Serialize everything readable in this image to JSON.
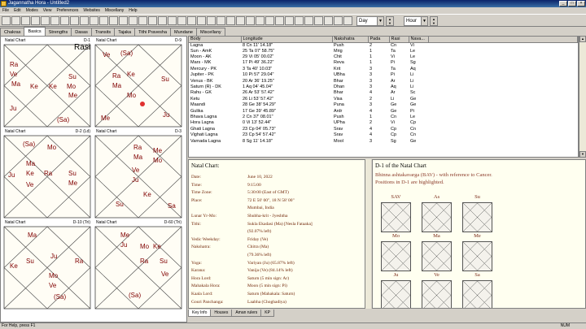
{
  "window": {
    "title": "Jagannatha Hora - Untitled2",
    "controls": [
      "_",
      "□",
      "×"
    ]
  },
  "menu": [
    "File",
    "Edit",
    "Modes",
    "View",
    "Preferences",
    "Websites",
    "Miscellany",
    "Help"
  ],
  "toolbar": {
    "unit_select": "Day",
    "unit_select2": "Hour"
  },
  "tabs": [
    "Chakras",
    "Basics",
    "Strengths",
    "Dasas",
    "Transits",
    "Tajaka",
    "Tithi Pravesha",
    "Mundane",
    "Miscellany"
  ],
  "active_tab": "Basics",
  "charts": [
    {
      "title": "Natal Chart",
      "right": "D-1",
      "center": "Rasi"
    },
    {
      "title": "Natal Chart",
      "right": "D-9"
    },
    {
      "title": "Natal Chart",
      "right": "D-2 (Ld)"
    },
    {
      "title": "Natal Chart",
      "right": "D-3"
    },
    {
      "title": "Natal Chart",
      "right": "D-10 (Tri)"
    },
    {
      "title": "Natal Chart",
      "right": "D-60 (Tri)"
    }
  ],
  "table": {
    "headers": [
      "Body",
      "Longitude",
      "Nakshatra",
      "Pada",
      "Rasi",
      "Nava..."
    ],
    "rows": [
      [
        "Lagna",
        "8 Cn 11' 14.18\"",
        "Push",
        "2",
        "Cn",
        "Vi"
      ],
      [
        "Sun - AmK",
        "25 Ta 07' 58.75\"",
        "Mrig",
        "1",
        "Ta",
        "Le"
      ],
      [
        "Moon - AK",
        "29 Vi 05' 00.02\"",
        "Chit",
        "1",
        "Vi",
        "Le"
      ],
      [
        "Mars - MK",
        "17 Pi 49' 36.22\"",
        "Reva",
        "1",
        "Pi",
        "Sg"
      ],
      [
        "Mercury - PK",
        "3 Ta 40' 10.03\"",
        "Krit",
        "3",
        "Ta",
        "Aq"
      ],
      [
        "Jupiter - PK",
        "10 Pi 57' 29.04\"",
        "UBha",
        "3",
        "Pi",
        "Li"
      ],
      [
        "Venus - BK",
        "20 Ar 36' 19.25\"",
        "Bhar",
        "3",
        "Ar",
        "Li"
      ],
      [
        "Saturn (R) - DK",
        "1 Aq 04' 45.04\"",
        "Dhan",
        "3",
        "Aq",
        "Li"
      ],
      [
        "Rahu - GK",
        "26 Ar 53' 57.42\"",
        "Bhar",
        "4",
        "Ar",
        "Sc"
      ],
      [
        "Ketu",
        "26 Li 53' 57.42\"",
        "Visa",
        "2",
        "Li",
        "Ge"
      ],
      [
        "Maandi",
        "28 Ge 38' 54.29\"",
        "Puna",
        "3",
        "Ge",
        "Ge"
      ],
      [
        "Gulika",
        "17 Ge 39' 45.89\"",
        "Ardr",
        "4",
        "Ge",
        "Pi"
      ],
      [
        "Bhava Lagna",
        "2 Cn 37' 08.01\"",
        "Push",
        "1",
        "Cn",
        "Le"
      ],
      [
        "Hora Lagna",
        "0 Vi 13' 52.44\"",
        "UPha",
        "2",
        "Vi",
        "Cp"
      ],
      [
        "Ghati Lagna",
        "23 Cp 04' 05.73\"",
        "Srav",
        "4",
        "Cp",
        "Cn"
      ],
      [
        "Vighati Lagna",
        "23 Cp 54' 57.42\"",
        "Srav",
        "4",
        "Cp",
        "Cn"
      ],
      [
        "Varnada Lagna",
        "8 Sg 11' 14.18\"",
        "Mool",
        "3",
        "Sg",
        "Ge"
      ]
    ]
  },
  "info": {
    "title": "Natal Chart:",
    "rows": [
      [
        "Date:",
        "June 10, 2022"
      ],
      [
        "Time:",
        "9:15:00"
      ],
      [
        "Time Zone:",
        "5:30:00 (East of GMT)"
      ],
      [
        "Place:",
        "72 E 50' 00\", 18 N 58' 00\""
      ],
      [
        "",
        "Mumbai, India"
      ],
      [
        "Lunar Yr-Mo:",
        "Shubha-krit - Jyeshtha"
      ],
      [
        "Tithi:",
        "Sukla Ekadasi (Ma) [Nesla Fataaka]"
      ],
      [
        "",
        "(92.07% left)"
      ],
      [
        "Vedic Weekday:",
        "Friday (Ve)"
      ],
      [
        "Nakshatra:",
        "Chitra (Ma)"
      ],
      [
        "",
        "(79.36% left)"
      ],
      [
        "Yoga:",
        "Variyan (Ju) (65.87% left)"
      ],
      [
        "Karana:",
        "Vanija (Ve) (84.14% left)"
      ],
      [
        "Hora Lord:",
        "Saturn (5 min sign: Ar)"
      ],
      [
        "Mahakala Hora:",
        "Moon (5 min sign: Pi)"
      ],
      [
        "Kaala Lord:",
        "Saturn (Mahakala: Saturn)"
      ],
      [
        "Gouri Panchanga:",
        "Laabha (Choghadiya)"
      ]
    ]
  },
  "bav": {
    "title": "D-1 of the Natal Chart",
    "desc1": "Bhinna ashtakavarga (BAV) - with reference to Cancer.",
    "desc2": "Positions in D-1 are highlighted.",
    "labels": [
      "SAV",
      "As",
      "Su",
      "Mo",
      "Ma",
      "Me",
      "Ju",
      "Ve",
      "Sa"
    ]
  },
  "bottom_tabs": [
    "Key Info",
    "Houses",
    "Aman rulers",
    "KP"
  ],
  "status": {
    "left": "For Help, press F1",
    "right": "NUM"
  },
  "chart1_planets": [
    "Ra",
    "Ve",
    "Ma",
    "Ke",
    "Ju",
    "Ke",
    "Su",
    "Mo",
    "Me",
    "(Sa)"
  ],
  "chart2_planets": [
    "Ve",
    "(Sa)",
    "Ra",
    "Ma",
    "Ke",
    "Mo",
    "Me",
    "Su",
    "Ju"
  ],
  "chart3_planets": [
    "(Sa)",
    "Mo",
    "Ma",
    "Ke",
    "Ju",
    "Ve",
    "Ra",
    "Su",
    "Me"
  ],
  "chart4_planets": [
    "Ra",
    "Ma",
    "Me",
    "Mo",
    "Ve",
    "Ju",
    "Ke",
    "Sa",
    "Su"
  ],
  "chart5_planets": [
    "Ma",
    "Su",
    "Ke",
    "Ju",
    "Ra",
    "Mo",
    "Ve",
    "(Sa)"
  ],
  "chart6_planets": [
    "Me",
    "Ju",
    "Mo",
    "Ke",
    "Ra",
    "Su",
    "Ve",
    "(Sa)"
  ]
}
